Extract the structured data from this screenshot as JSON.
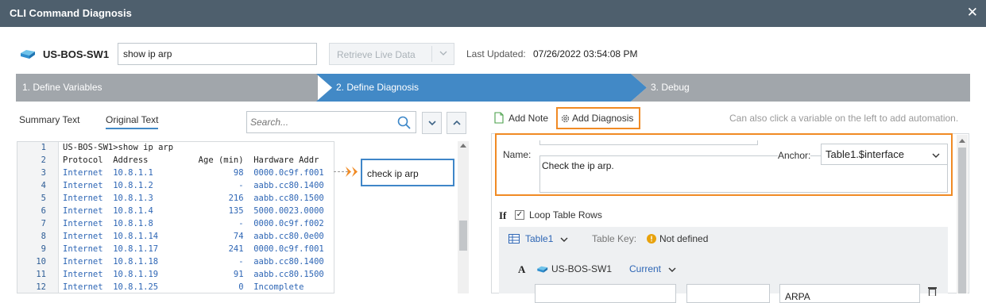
{
  "window": {
    "title": "CLI Command Diagnosis",
    "close": "✕"
  },
  "toolbar": {
    "device": "US-BOS-SW1",
    "command_value": "show ip arp",
    "retrieve_label": "Retrieve Live Data",
    "last_updated_label": "Last Updated:",
    "last_updated_value": "07/26/2022 03:54:08 PM"
  },
  "steps": [
    {
      "label": "1. Define Variables"
    },
    {
      "label": "2. Define Diagnosis"
    },
    {
      "label": "3. Debug"
    }
  ],
  "left": {
    "tabs": [
      {
        "label": "Summary Text"
      },
      {
        "label": "Original Text"
      }
    ],
    "search_placeholder": "Search...",
    "lines": [
      {
        "n": "1",
        "text": "US-BOS-SW1>show ip arp"
      },
      {
        "n": "2",
        "text": "Protocol  Address          Age (min)  Hardware Addr"
      },
      {
        "n": "3",
        "text": "Internet  10.8.1.1                98  0000.0c9f.f001"
      },
      {
        "n": "4",
        "text": "Internet  10.8.1.2                 -  aabb.cc80.1400"
      },
      {
        "n": "5",
        "text": "Internet  10.8.1.3               216  aabb.cc80.1500"
      },
      {
        "n": "6",
        "text": "Internet  10.8.1.4               135  5000.0023.0000"
      },
      {
        "n": "7",
        "text": "Internet  10.8.1.8                 -  0000.0c9f.f002"
      },
      {
        "n": "8",
        "text": "Internet  10.8.1.14               74  aabb.cc80.0e00"
      },
      {
        "n": "9",
        "text": "Internet  10.8.1.17              241  0000.0c9f.f001"
      },
      {
        "n": "10",
        "text": "Internet  10.8.1.18                -  aabb.cc80.1400"
      },
      {
        "n": "11",
        "text": "Internet  10.8.1.19               91  aabb.cc80.1500"
      },
      {
        "n": "12",
        "text": "Internet  10.8.1.25                0  Incomplete"
      }
    ],
    "diagnosis_tag": "check ip arp"
  },
  "right": {
    "add_note": "Add Note",
    "add_diagnosis": "Add Diagnosis",
    "hint": "Can also click a variable on the left to add automation.",
    "name_label": "Name:",
    "name_value": "Check the ip arp.",
    "anchor_label": "Anchor:",
    "anchor_value": "Table1.$interface",
    "if_label": "If",
    "loop_label": "Loop Table Rows",
    "table_name": "Table1",
    "table_key_label": "Table Key:",
    "table_key_value": "Not defined",
    "row_letter": "A",
    "row_device": "US-BOS-SW1",
    "row_mode": "Current",
    "row_field3": "ARPA"
  },
  "colors": {
    "accent": "#4289c6",
    "highlight": "#f08a24",
    "titlebar": "#4e5f6d"
  }
}
